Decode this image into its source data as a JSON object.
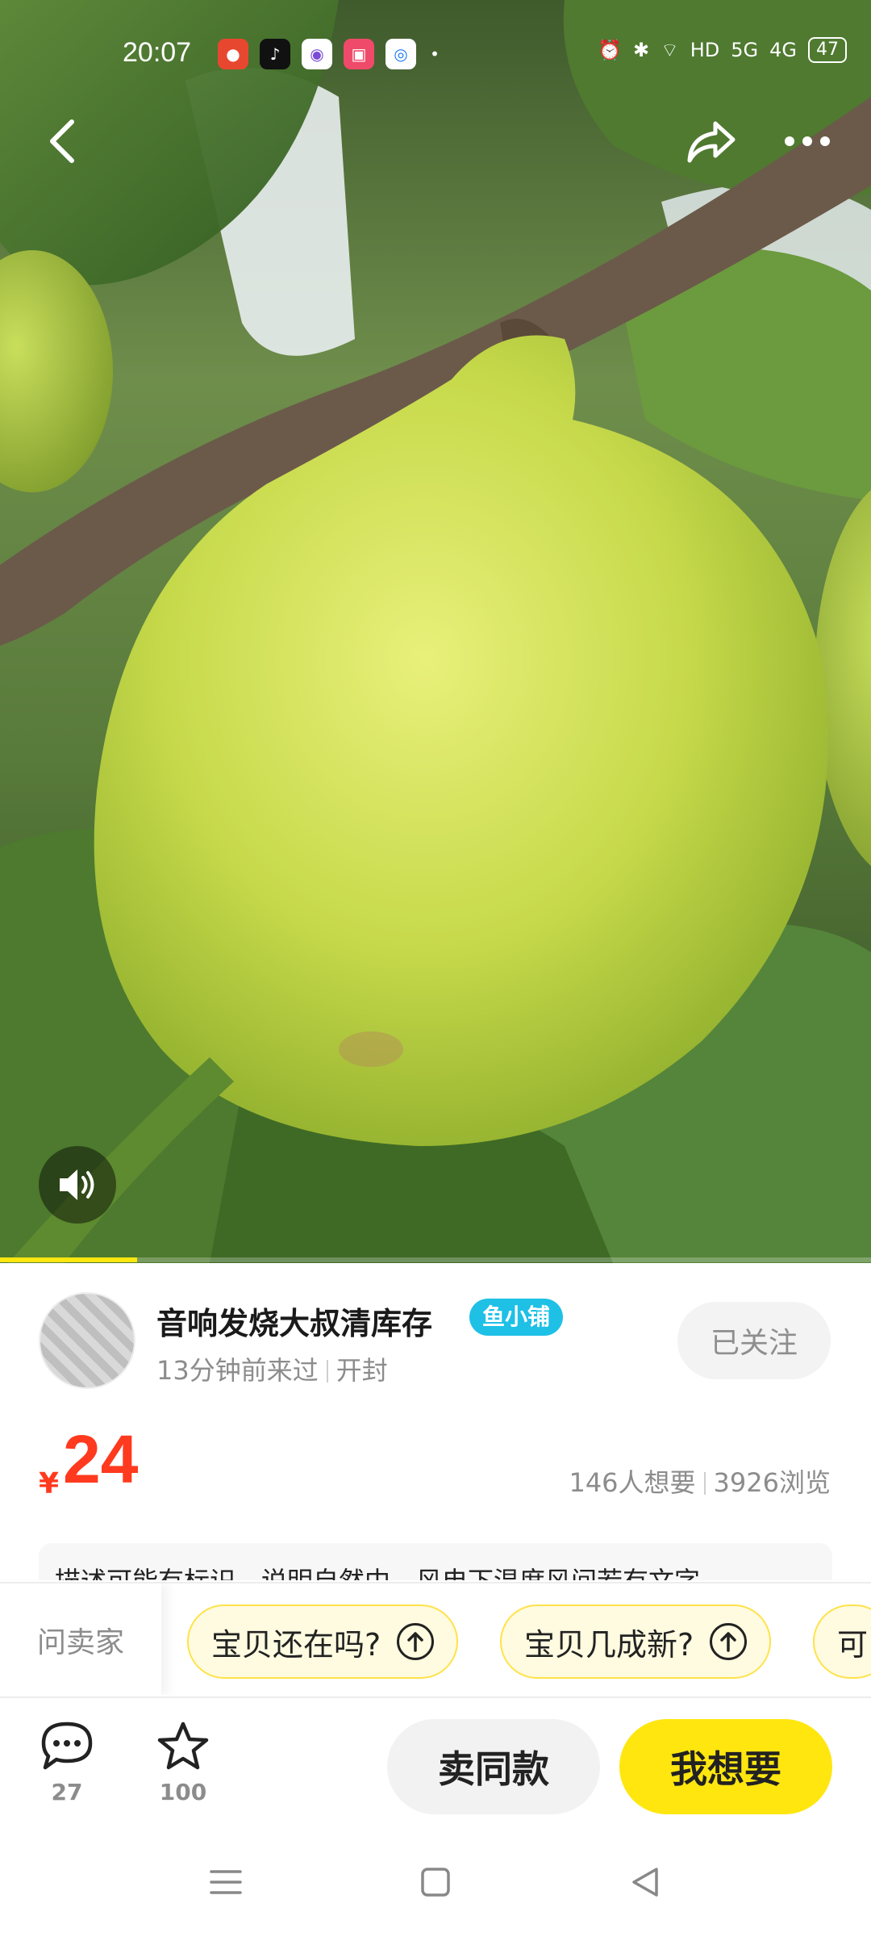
{
  "status_bar": {
    "time": "20:07",
    "battery": "47",
    "network_labels": [
      "HD",
      "5G",
      "4G"
    ]
  },
  "hero": {
    "image_description": "green fig on branch",
    "progress_fraction": 0.157
  },
  "seller": {
    "name": "音响发烧大叔清库存",
    "badge": "鱼小铺",
    "last_seen": "13分钟前来过",
    "condition": "开封",
    "follow_label": "已关注"
  },
  "price": {
    "currency": "¥",
    "amount": "24",
    "wants": "146人想要",
    "views": "3926浏览"
  },
  "description_preview": "描述可能有标识，说明自然中，风电下温度风间若有文字",
  "ask_bar": {
    "label": "问卖家",
    "chips": [
      "宝贝还在吗?",
      "宝贝几成新?",
      "可"
    ]
  },
  "actions": {
    "comments_count": "27",
    "favorites_count": "100",
    "same_label": "卖同款",
    "want_label": "我想要"
  },
  "colors": {
    "accent_yellow": "#ffe60f",
    "price_red": "#ff3a1e",
    "badge_blue": "#1ec0e6"
  }
}
